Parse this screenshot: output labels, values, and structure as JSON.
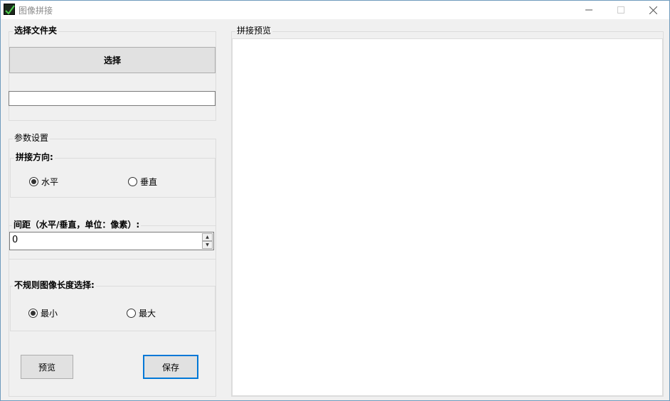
{
  "window": {
    "title": "图像拼接",
    "icon": "checkmark-app-icon",
    "controls": [
      "minimize-icon",
      "maximize-icon",
      "close-icon"
    ]
  },
  "folder_group": {
    "title": "选择文件夹",
    "select_button": "选择",
    "path_value": ""
  },
  "params_group": {
    "title": "参数设置",
    "direction": {
      "title": "拼接方向:",
      "options": [
        {
          "label": "水平",
          "checked": true
        },
        {
          "label": "垂直",
          "checked": false
        }
      ]
    },
    "spacing": {
      "title": "间距（水平/垂直，单位：像素）:",
      "value": "0"
    },
    "irregular": {
      "title": "不规则图像长度选择:",
      "options": [
        {
          "label": "最小",
          "checked": true
        },
        {
          "label": "最大",
          "checked": false
        }
      ]
    }
  },
  "actions": {
    "preview_button": "预览",
    "save_button": "保存"
  },
  "preview_panel": {
    "title": "拼接预览"
  },
  "colors": {
    "accent": "#0078d7",
    "window_bg": "#f0f0f0",
    "button_bg": "#e1e1e1"
  }
}
